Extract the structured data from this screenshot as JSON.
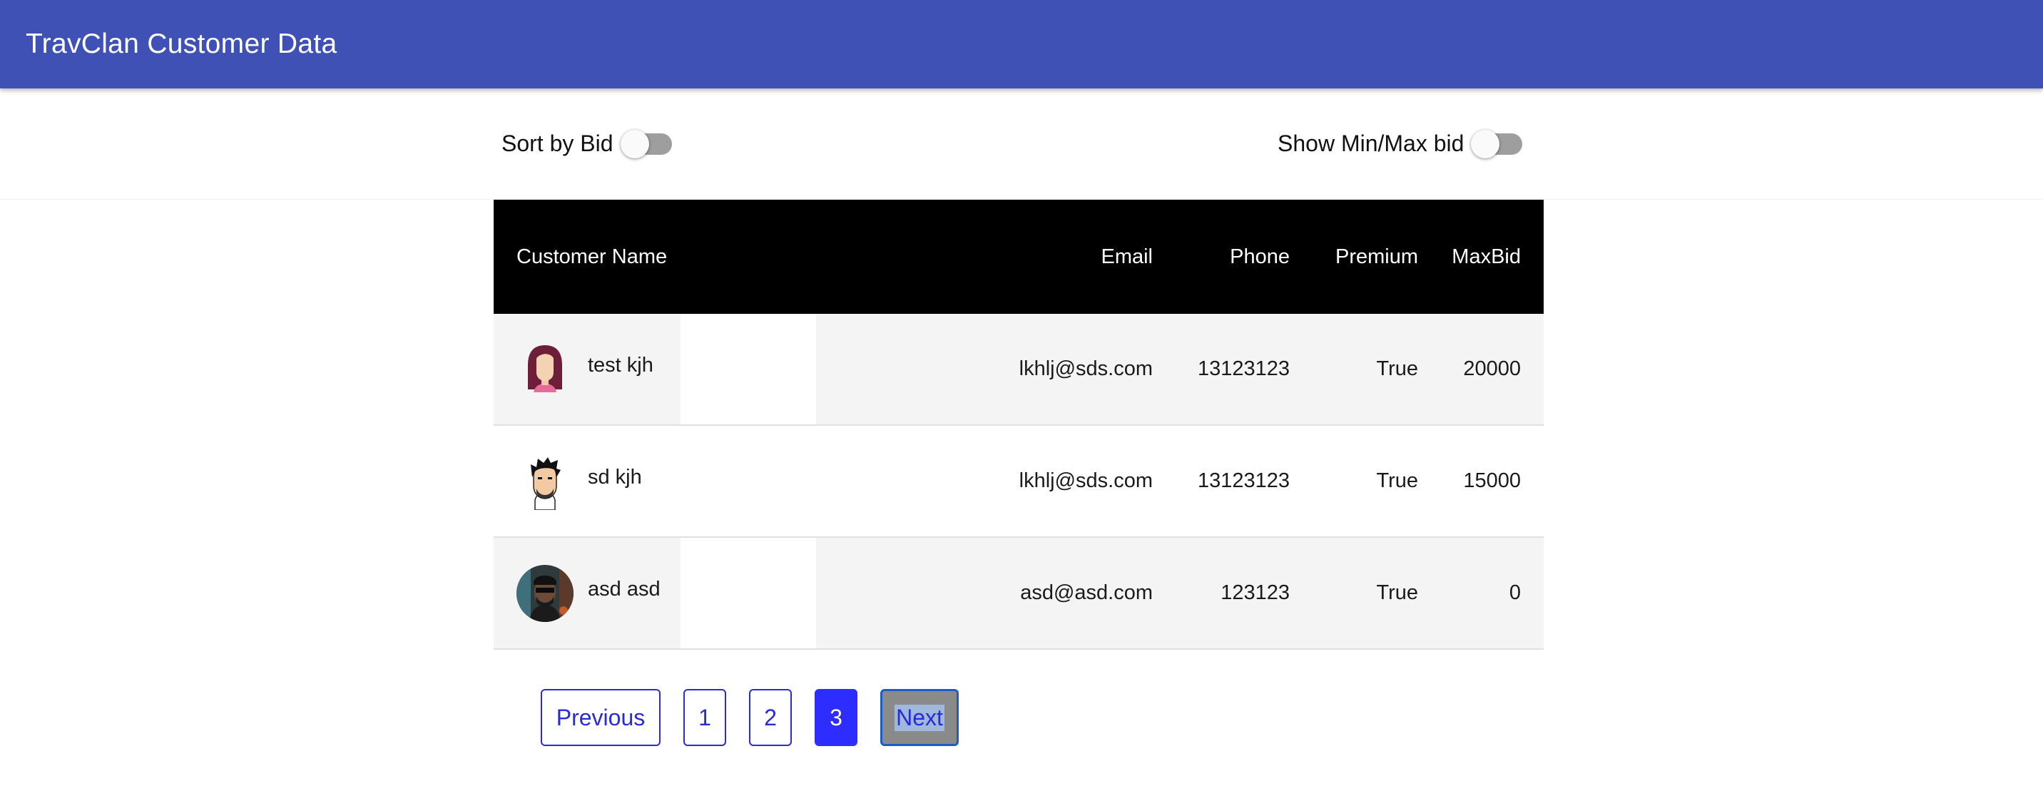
{
  "app": {
    "title": "TravClan Customer Data"
  },
  "controls": {
    "sort_label": "Sort by Bid",
    "sort_on": false,
    "minmax_label": "Show Min/Max bid",
    "minmax_on": false
  },
  "table": {
    "columns": [
      "Customer Name",
      "Email",
      "Phone",
      "Premium",
      "Max",
      "Bid"
    ],
    "rows": [
      {
        "name": "test kjh",
        "email": "lkhlj@sds.com",
        "phone": "13123123",
        "premium": "True",
        "max_bid": "20000",
        "avatar": "female-avatar"
      },
      {
        "name": "sd kjh",
        "email": "lkhlj@sds.com",
        "phone": "13123123",
        "premium": "True",
        "max_bid": "15000",
        "avatar": "male-cartoon-avatar"
      },
      {
        "name": "asd asd",
        "email": "asd@asd.com",
        "phone": "123123",
        "premium": "True",
        "max_bid": "0",
        "avatar": "photo-avatar"
      }
    ]
  },
  "pagination": {
    "previous": "Previous",
    "pages": [
      "1",
      "2",
      "3"
    ],
    "current": "3",
    "next": "Next"
  },
  "colors": {
    "appbar": "#3f51b5",
    "table_header": "#000000",
    "page_active": "#2d2dff",
    "page_border": "#2a2ad8"
  }
}
